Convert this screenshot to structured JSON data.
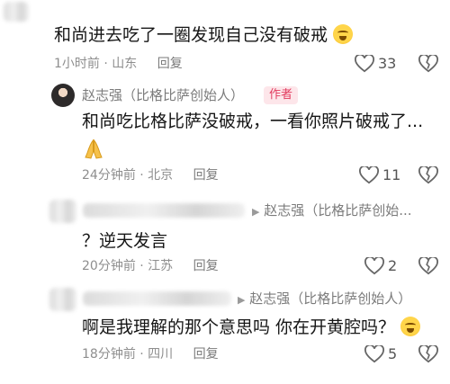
{
  "comments": [
    {
      "text": "和尚进去吃了一圈发现自己没有破戒",
      "time": "1小时前 · 山东",
      "reply": "回复",
      "likes": "33"
    },
    {
      "author": "赵志强（比格比萨创始人）",
      "badge": "作者",
      "text": "和尚吃比格比萨没破戒，一看你照片破戒了...",
      "time": "24分钟前 · 北京",
      "reply": "回复",
      "likes": "11"
    },
    {
      "reply_to": "赵志强（比格比萨创始...",
      "text": "？逆天发言",
      "time": "20分钟前 · 江苏",
      "reply": "回复",
      "likes": "2"
    },
    {
      "reply_to": "赵志强（比格比萨创始人）",
      "text": "啊是我理解的那个意思吗 你在开黄腔吗？",
      "time": "18分钟前 · 四川",
      "reply": "回复",
      "likes": "5"
    }
  ],
  "icons": {
    "like": "heart-icon",
    "dislike": "broken-heart-icon",
    "emoji_cry_laugh": "crying-laughing-emoji",
    "emoji_pray": "praying-hands-emoji",
    "reply_arrow": "triangle-right-icon"
  },
  "colors": {
    "badge_bg": "#fde6ea",
    "badge_text": "#e23b5e",
    "meta": "#8e8e8e"
  }
}
